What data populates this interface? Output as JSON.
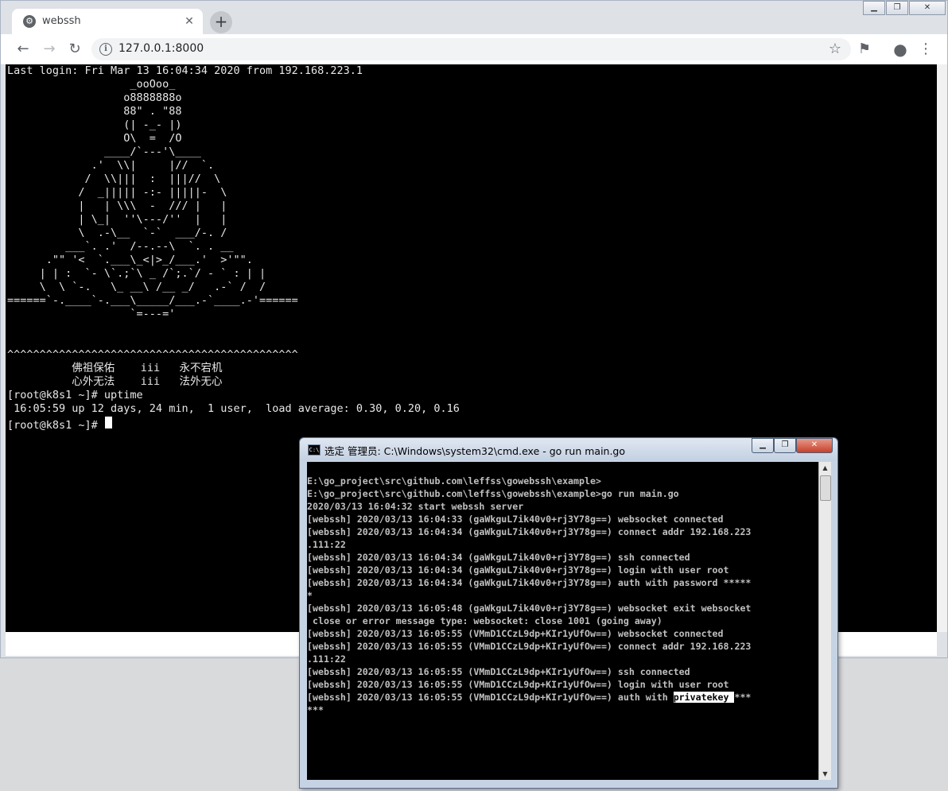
{
  "browser": {
    "tab_title": "webssh",
    "new_tab_symbol": "+",
    "tab_close_symbol": "✕",
    "url": "127.0.0.1:8000",
    "favicon": "gear-favicon-icon",
    "nav": {
      "back": "back-arrow-icon",
      "forward": "forward-arrow-icon",
      "reload": "reload-icon",
      "bookmark": "star-icon",
      "flag": "flag-icon",
      "account": "account-icon",
      "menu": "kebab-menu-icon"
    },
    "window_controls": [
      "▁",
      "❐",
      "✕"
    ]
  },
  "terminal": {
    "lines": [
      "Last login: Fri Mar 13 16:04:34 2020 from 192.168.223.1",
      "                   _ooOoo_",
      "                  o8888888o",
      "                  88\" . \"88",
      "                  (| -_- |)",
      "                  O\\  =  /O",
      "               ____/`---'\\____",
      "             .'  \\\\|     |//  `.",
      "            /  \\\\|||  :  |||//  \\",
      "           /  _||||| -:- |||||-  \\",
      "           |   | \\\\\\  -  /// |   |",
      "           | \\_|  ''\\---/''  |   |",
      "           \\  .-\\__  `-`  ___/-. /",
      "         ___`. .'  /--.--\\  `. . __",
      "      .\"\" '<  `.___\\_<|>_/___.'  >'\"\".",
      "     | | :  `- \\`.;`\\ _ /`;.`/ - ` : | |",
      "     \\  \\ `-.   \\_ __\\ /__ _/   .-` /  /",
      "======`-.____`-.___\\_____/___.-`____.-'======",
      "                   `=---='",
      "",
      "",
      "^^^^^^^^^^^^^^^^^^^^^^^^^^^^^^^^^^^^^^^^^^^^^",
      "          佛祖保佑    iii   永不宕机",
      "          心外无法    iii   法外无心",
      "[root@k8s1 ~]# uptime",
      " 16:05:59 up 12 days, 24 min,  1 user,  load average: 0.30, 0.20, 0.16"
    ],
    "prompt": "[root@k8s1 ~]# "
  },
  "cmd_window": {
    "title": "选定 管理员: C:\\Windows\\system32\\cmd.exe - go  run main.go",
    "icon_text": "C:\\",
    "buttons": [
      "▁",
      "❐",
      "✕"
    ],
    "lines": [
      "E:\\go_project\\src\\github.com\\leffss\\gowebssh\\example>",
      "E:\\go_project\\src\\github.com\\leffss\\gowebssh\\example>go run main.go",
      "2020/03/13 16:04:32 start webssh server",
      "[webssh] 2020/03/13 16:04:33 (gaWkguL7ik40v0+rj3Y78g==) websocket connected",
      "[webssh] 2020/03/13 16:04:34 (gaWkguL7ik40v0+rj3Y78g==) connect addr 192.168.223",
      ".111:22",
      "[webssh] 2020/03/13 16:04:34 (gaWkguL7ik40v0+rj3Y78g==) ssh connected",
      "[webssh] 2020/03/13 16:04:34 (gaWkguL7ik40v0+rj3Y78g==) login with user root",
      "[webssh] 2020/03/13 16:04:34 (gaWkguL7ik40v0+rj3Y78g==) auth with password *****",
      "*",
      "[webssh] 2020/03/13 16:05:48 (gaWkguL7ik40v0+rj3Y78g==) websocket exit websocket",
      " close or error message type: websocket: close 1001 (going away)",
      "[webssh] 2020/03/13 16:05:55 (VMmD1CCzL9dp+KIr1yUfOw==) websocket connected",
      "[webssh] 2020/03/13 16:05:55 (VMmD1CCzL9dp+KIr1yUfOw==) connect addr 192.168.223",
      ".111:22",
      "[webssh] 2020/03/13 16:05:55 (VMmD1CCzL9dp+KIr1yUfOw==) ssh connected",
      "[webssh] 2020/03/13 16:05:55 (VMmD1CCzL9dp+KIr1yUfOw==) login with user root"
    ],
    "last_line_prefix": "[webssh] 2020/03/13 16:05:55 (VMmD1CCzL9dp+KIr1yUfOw==) auth with ",
    "last_line_highlight": "privatekey ",
    "last_line_suffix": "***",
    "wrap_line": "***",
    "colors": {
      "cmd_background": "#000000",
      "terminal_background": "#000000",
      "titlebar": "#c4d1e2",
      "close_button": "#c7402a"
    }
  }
}
